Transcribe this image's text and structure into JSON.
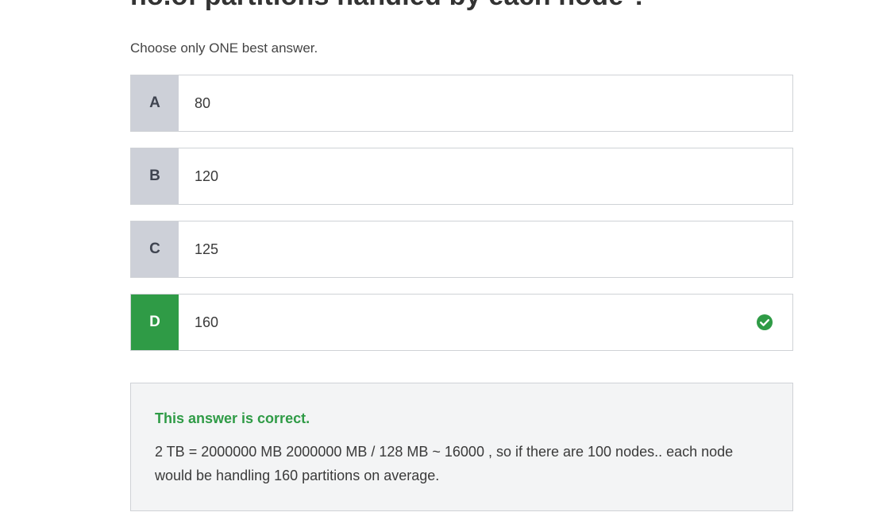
{
  "question": {
    "title": "no.of partitions handled by each node ?",
    "instruction": "Choose only ONE best answer."
  },
  "options": [
    {
      "letter": "A",
      "text": "80"
    },
    {
      "letter": "B",
      "text": "120"
    },
    {
      "letter": "C",
      "text": "125"
    },
    {
      "letter": "D",
      "text": "160"
    }
  ],
  "selected_option": "D",
  "colors": {
    "correct": "#2f9b46",
    "letter_bg": "#cdd0d8",
    "border": "#cfd2d6",
    "feedback_bg": "#f3f4f5"
  },
  "feedback": {
    "status": "This answer is correct.",
    "explanation": "2 TB = 2000000 MB 2000000 MB / 128 MB ~ 16000 , so if there are 100 nodes.. each node would be handling 160 partitions on average."
  }
}
